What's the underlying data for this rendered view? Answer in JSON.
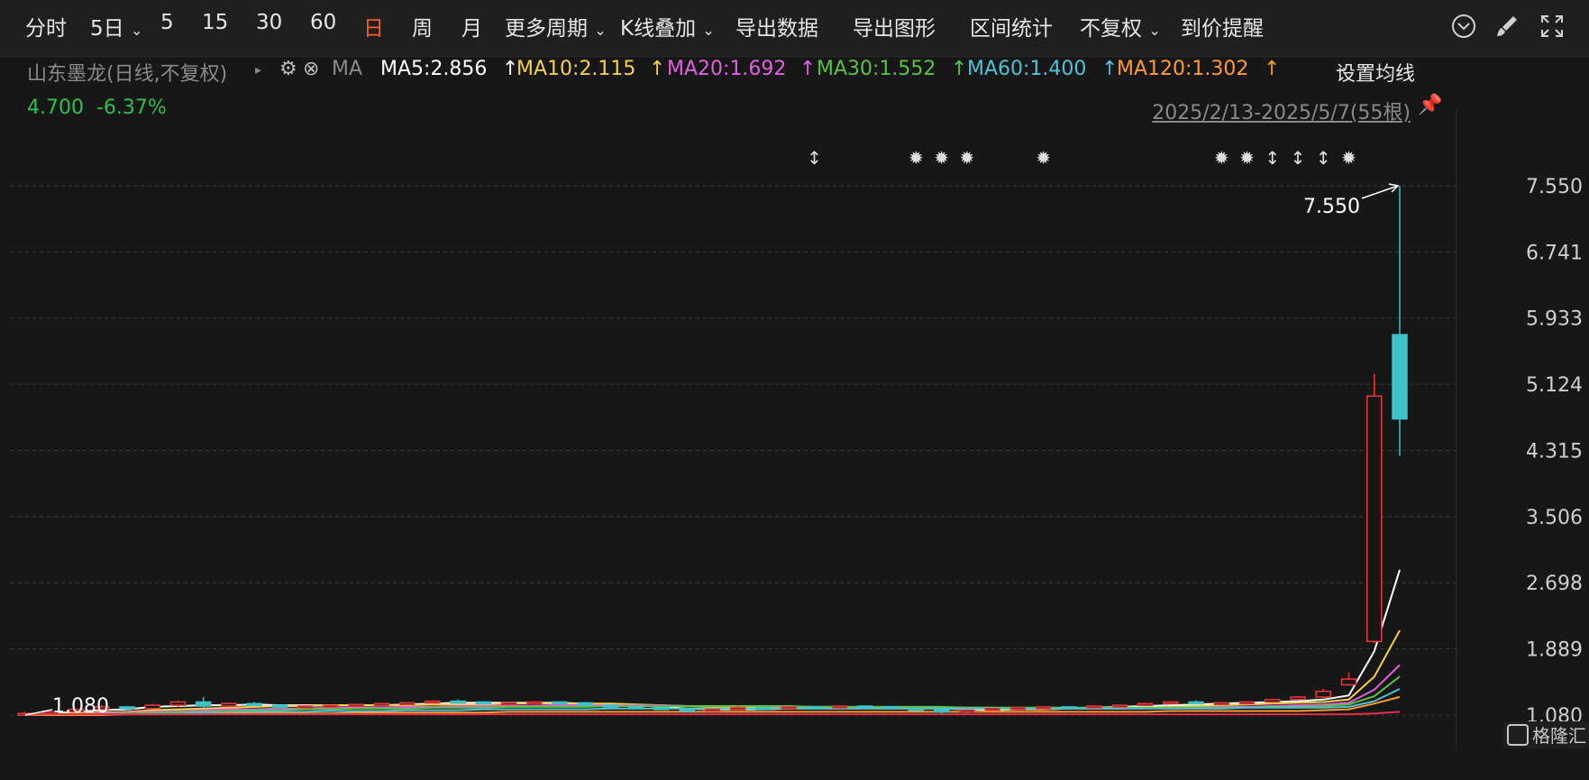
{
  "toolbar": {
    "items": [
      "分时",
      "5日",
      "5",
      "15",
      "30",
      "60",
      "日",
      "周",
      "月",
      "更多周期",
      "K线叠加",
      "导出数据",
      "导出图形",
      "区间统计",
      "不复权",
      "到价提醒"
    ],
    "active": "日"
  },
  "ma_header": {
    "stock": "山东墨龙(日线,不复权)",
    "ma_label": "MA",
    "ma_settings": "设置均线",
    "lines": [
      {
        "text": "MA5:2.856",
        "color": "#ffffff"
      },
      {
        "text": "MA10:2.115",
        "color": "#f5d04a"
      },
      {
        "text": "MA20:1.692",
        "color": "#e060e0"
      },
      {
        "text": "MA30:1.552",
        "color": "#5cc040"
      },
      {
        "text": "MA60:1.400",
        "color": "#4ec3d8"
      },
      {
        "text": "MA120:1.302",
        "color": "#ff9a30"
      }
    ]
  },
  "info": {
    "price": "4.700",
    "change": "-6.37%",
    "range": "2025/2/13-2025/5/7(55根)"
  },
  "watermark": "格隆汇",
  "chart_data": {
    "type": "candlestick",
    "y_ticks": [
      "7.550",
      "6.741",
      "5.933",
      "5.124",
      "4.315",
      "3.506",
      "2.698",
      "1.889",
      "1.080"
    ],
    "ylim": [
      1.08,
      7.55
    ],
    "annotations": {
      "high": "7.550",
      "low": "1.080"
    },
    "candles": [
      [
        1.08,
        1.1,
        1.08,
        1.12
      ],
      [
        1.1,
        1.12,
        1.09,
        1.13
      ],
      [
        1.12,
        1.15,
        1.11,
        1.16
      ],
      [
        1.15,
        1.18,
        1.14,
        1.2
      ],
      [
        1.18,
        1.16,
        1.14,
        1.19
      ],
      [
        1.16,
        1.2,
        1.15,
        1.22
      ],
      [
        1.2,
        1.24,
        1.18,
        1.26
      ],
      [
        1.24,
        1.19,
        1.17,
        1.3
      ],
      [
        1.19,
        1.22,
        1.18,
        1.23
      ],
      [
        1.22,
        1.2,
        1.19,
        1.24
      ],
      [
        1.2,
        1.18,
        1.17,
        1.21
      ],
      [
        1.18,
        1.19,
        1.17,
        1.2
      ],
      [
        1.19,
        1.2,
        1.18,
        1.21
      ],
      [
        1.2,
        1.21,
        1.19,
        1.22
      ],
      [
        1.21,
        1.22,
        1.2,
        1.23
      ],
      [
        1.22,
        1.23,
        1.21,
        1.24
      ],
      [
        1.23,
        1.25,
        1.22,
        1.26
      ],
      [
        1.25,
        1.24,
        1.23,
        1.27
      ],
      [
        1.24,
        1.22,
        1.21,
        1.25
      ],
      [
        1.22,
        1.23,
        1.21,
        1.24
      ],
      [
        1.23,
        1.24,
        1.22,
        1.25
      ],
      [
        1.24,
        1.23,
        1.22,
        1.25
      ],
      [
        1.23,
        1.2,
        1.19,
        1.24
      ],
      [
        1.2,
        1.18,
        1.17,
        1.21
      ],
      [
        1.18,
        1.17,
        1.16,
        1.19
      ],
      [
        1.17,
        1.15,
        1.14,
        1.18
      ],
      [
        1.15,
        1.13,
        1.12,
        1.16
      ],
      [
        1.13,
        1.15,
        1.12,
        1.16
      ],
      [
        1.15,
        1.17,
        1.14,
        1.2
      ],
      [
        1.17,
        1.16,
        1.15,
        1.18
      ],
      [
        1.16,
        1.18,
        1.15,
        1.19
      ],
      [
        1.18,
        1.17,
        1.16,
        1.19
      ],
      [
        1.17,
        1.19,
        1.16,
        1.2
      ],
      [
        1.19,
        1.18,
        1.17,
        1.2
      ],
      [
        1.18,
        1.16,
        1.15,
        1.19
      ],
      [
        1.16,
        1.14,
        1.13,
        1.17
      ],
      [
        1.14,
        1.12,
        1.1,
        1.15
      ],
      [
        1.12,
        1.14,
        1.1,
        1.15
      ],
      [
        1.14,
        1.16,
        1.13,
        1.17
      ],
      [
        1.16,
        1.17,
        1.15,
        1.18
      ],
      [
        1.17,
        1.18,
        1.16,
        1.19
      ],
      [
        1.18,
        1.17,
        1.16,
        1.19
      ],
      [
        1.17,
        1.19,
        1.16,
        1.2
      ],
      [
        1.19,
        1.2,
        1.18,
        1.21
      ],
      [
        1.2,
        1.22,
        1.19,
        1.23
      ],
      [
        1.22,
        1.24,
        1.21,
        1.25
      ],
      [
        1.24,
        1.22,
        1.21,
        1.26
      ],
      [
        1.22,
        1.23,
        1.21,
        1.24
      ],
      [
        1.23,
        1.24,
        1.22,
        1.25
      ],
      [
        1.24,
        1.27,
        1.23,
        1.28
      ],
      [
        1.27,
        1.3,
        1.26,
        1.31
      ],
      [
        1.3,
        1.37,
        1.29,
        1.4
      ],
      [
        1.45,
        1.52,
        1.44,
        1.6
      ],
      [
        1.98,
        4.98,
        1.96,
        5.25
      ],
      [
        5.73,
        4.7,
        4.25,
        7.55
      ]
    ],
    "ma": {
      "MA5": {
        "color": "#ffffff",
        "values": [
          1.08,
          1.1,
          1.12,
          1.14,
          1.15,
          1.18,
          1.19,
          1.2,
          1.2,
          1.21,
          1.2,
          1.2,
          1.2,
          1.2,
          1.2,
          1.21,
          1.22,
          1.23,
          1.23,
          1.23,
          1.23,
          1.23,
          1.22,
          1.21,
          1.2,
          1.18,
          1.16,
          1.15,
          1.15,
          1.15,
          1.16,
          1.17,
          1.17,
          1.18,
          1.17,
          1.17,
          1.16,
          1.15,
          1.14,
          1.15,
          1.15,
          1.16,
          1.17,
          1.18,
          1.19,
          1.2,
          1.21,
          1.22,
          1.23,
          1.24,
          1.25,
          1.27,
          1.32,
          1.86,
          2.856
        ]
      },
      "MA10": {
        "color": "#f5d04a",
        "values": [
          1.08,
          1.09,
          1.1,
          1.11,
          1.12,
          1.14,
          1.15,
          1.16,
          1.17,
          1.18,
          1.19,
          1.19,
          1.2,
          1.2,
          1.2,
          1.2,
          1.21,
          1.21,
          1.21,
          1.22,
          1.22,
          1.22,
          1.22,
          1.22,
          1.21,
          1.2,
          1.19,
          1.18,
          1.18,
          1.17,
          1.16,
          1.16,
          1.16,
          1.16,
          1.16,
          1.16,
          1.16,
          1.16,
          1.15,
          1.15,
          1.15,
          1.16,
          1.16,
          1.16,
          1.17,
          1.18,
          1.19,
          1.2,
          1.21,
          1.22,
          1.23,
          1.24,
          1.27,
          1.55,
          2.115
        ]
      },
      "MA20": {
        "color": "#e060e0",
        "values": [
          1.08,
          1.08,
          1.09,
          1.1,
          1.11,
          1.12,
          1.13,
          1.14,
          1.15,
          1.15,
          1.16,
          1.16,
          1.17,
          1.17,
          1.17,
          1.18,
          1.18,
          1.19,
          1.19,
          1.19,
          1.19,
          1.2,
          1.2,
          1.2,
          1.2,
          1.2,
          1.19,
          1.19,
          1.19,
          1.19,
          1.18,
          1.18,
          1.18,
          1.17,
          1.17,
          1.17,
          1.17,
          1.17,
          1.17,
          1.16,
          1.16,
          1.16,
          1.16,
          1.16,
          1.16,
          1.17,
          1.17,
          1.18,
          1.18,
          1.19,
          1.2,
          1.21,
          1.23,
          1.39,
          1.692
        ]
      },
      "MA30": {
        "color": "#5cc040",
        "values": [
          1.08,
          1.08,
          1.09,
          1.09,
          1.1,
          1.11,
          1.12,
          1.12,
          1.13,
          1.14,
          1.14,
          1.15,
          1.15,
          1.16,
          1.16,
          1.16,
          1.17,
          1.17,
          1.17,
          1.18,
          1.18,
          1.18,
          1.18,
          1.19,
          1.19,
          1.19,
          1.19,
          1.19,
          1.19,
          1.19,
          1.19,
          1.18,
          1.18,
          1.18,
          1.18,
          1.18,
          1.18,
          1.17,
          1.17,
          1.17,
          1.17,
          1.17,
          1.17,
          1.17,
          1.17,
          1.17,
          1.17,
          1.17,
          1.17,
          1.18,
          1.18,
          1.19,
          1.21,
          1.31,
          1.552
        ]
      },
      "MA60": {
        "color": "#4ec3d8",
        "values": [
          1.08,
          1.08,
          1.08,
          1.09,
          1.09,
          1.1,
          1.1,
          1.11,
          1.11,
          1.12,
          1.12,
          1.12,
          1.13,
          1.13,
          1.13,
          1.14,
          1.14,
          1.14,
          1.15,
          1.15,
          1.15,
          1.15,
          1.15,
          1.16,
          1.16,
          1.16,
          1.16,
          1.16,
          1.16,
          1.16,
          1.16,
          1.16,
          1.16,
          1.16,
          1.16,
          1.16,
          1.16,
          1.16,
          1.16,
          1.16,
          1.16,
          1.16,
          1.16,
          1.16,
          1.16,
          1.16,
          1.16,
          1.16,
          1.17,
          1.17,
          1.17,
          1.17,
          1.18,
          1.25,
          1.4
        ]
      },
      "MA120": {
        "color": "#ff9a30",
        "values": [
          1.08,
          1.08,
          1.08,
          1.08,
          1.09,
          1.09,
          1.09,
          1.09,
          1.1,
          1.1,
          1.1,
          1.1,
          1.1,
          1.11,
          1.11,
          1.11,
          1.11,
          1.11,
          1.11,
          1.12,
          1.12,
          1.12,
          1.12,
          1.12,
          1.12,
          1.12,
          1.12,
          1.12,
          1.12,
          1.12,
          1.12,
          1.12,
          1.12,
          1.12,
          1.12,
          1.12,
          1.12,
          1.12,
          1.12,
          1.12,
          1.12,
          1.12,
          1.12,
          1.12,
          1.12,
          1.13,
          1.13,
          1.13,
          1.13,
          1.13,
          1.13,
          1.14,
          1.15,
          1.22,
          1.302
        ]
      },
      "base": {
        "color": "#e0304a",
        "values": [
          1.09,
          1.09,
          1.09,
          1.09,
          1.09,
          1.09,
          1.09,
          1.09,
          1.09,
          1.09,
          1.09,
          1.09,
          1.09,
          1.09,
          1.09,
          1.09,
          1.09,
          1.09,
          1.09,
          1.09,
          1.09,
          1.09,
          1.09,
          1.09,
          1.09,
          1.09,
          1.09,
          1.09,
          1.09,
          1.09,
          1.09,
          1.09,
          1.09,
          1.09,
          1.09,
          1.09,
          1.09,
          1.09,
          1.09,
          1.09,
          1.09,
          1.09,
          1.09,
          1.09,
          1.09,
          1.09,
          1.09,
          1.09,
          1.09,
          1.09,
          1.09,
          1.09,
          1.09,
          1.1,
          1.12
        ]
      }
    },
    "markers": [
      {
        "i": 31,
        "type": "updown"
      },
      {
        "i": 35,
        "type": "sun"
      },
      {
        "i": 36,
        "type": "sun"
      },
      {
        "i": 37,
        "type": "sun"
      },
      {
        "i": 40,
        "type": "sun"
      },
      {
        "i": 47,
        "type": "sun"
      },
      {
        "i": 48,
        "type": "sun"
      },
      {
        "i": 49,
        "type": "updown"
      },
      {
        "i": 50,
        "type": "updown"
      },
      {
        "i": 51,
        "type": "updown"
      },
      {
        "i": 52,
        "type": "sun"
      }
    ]
  }
}
